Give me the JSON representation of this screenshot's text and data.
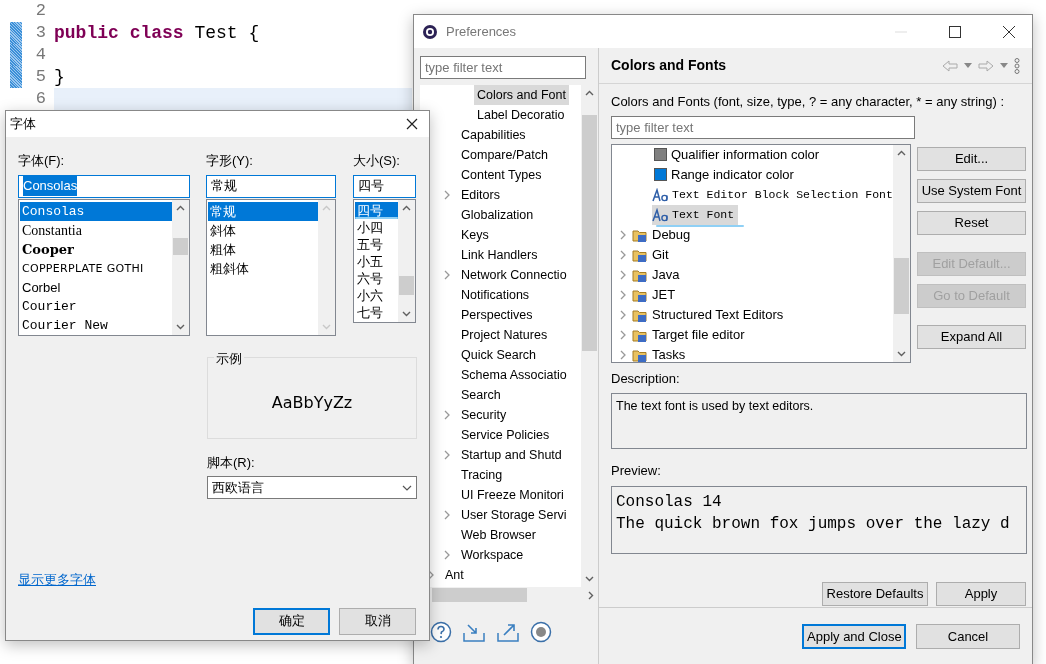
{
  "editor": {
    "lines": [
      {
        "number": "2",
        "changed": false,
        "current": false
      },
      {
        "number": "3",
        "changed": true,
        "current": false,
        "text": "**public** **class** Test {"
      },
      {
        "number": "4",
        "changed": true,
        "current": false
      },
      {
        "number": "5",
        "changed": true,
        "current": false,
        "text": "}"
      },
      {
        "number": "6",
        "changed": false,
        "current": true
      }
    ]
  },
  "preferences": {
    "title": "Preferences",
    "filter": {
      "placeholder": "type filter text"
    },
    "tree": [
      {
        "children": [
          {
            "children": [
              {
                "label": "Colors and Font",
                "expandable": false,
                "selected": true
              },
              {
                "label": "Label Decoratio",
                "expandable": false,
                "selected": false
              }
            ]
          },
          {
            "label": "Capabilities",
            "expandable": false,
            "selected": false
          },
          {
            "label": "Compare/Patch",
            "expandable": false,
            "selected": false
          },
          {
            "label": "Content Types",
            "expandable": false,
            "selected": false
          },
          {
            "label": "Editors",
            "expandable": true,
            "selected": false
          },
          {
            "label": "Globalization",
            "expandable": false,
            "selected": false
          },
          {
            "label": "Keys",
            "expandable": false,
            "selected": false
          },
          {
            "label": "Link Handlers",
            "expandable": false,
            "selected": false
          },
          {
            "label": "Network Connectio",
            "expandable": true,
            "selected": false
          },
          {
            "label": "Notifications",
            "expandable": false,
            "selected": false
          },
          {
            "label": "Perspectives",
            "expandable": false,
            "selected": false
          },
          {
            "label": "Project Natures",
            "expandable": false,
            "selected": false
          },
          {
            "label": "Quick Search",
            "expandable": false,
            "selected": false
          },
          {
            "label": "Schema Associatio",
            "expandable": false,
            "selected": false
          },
          {
            "label": "Search",
            "expandable": false,
            "selected": false
          },
          {
            "label": "Security",
            "expandable": true,
            "selected": false
          },
          {
            "label": "Service Policies",
            "expandable": false,
            "selected": false
          },
          {
            "label": "Startup and Shutd",
            "expandable": true,
            "selected": false
          },
          {
            "label": "Tracing",
            "expandable": false,
            "selected": false
          },
          {
            "label": "UI Freeze Monitori",
            "expandable": false,
            "selected": false
          },
          {
            "label": "User Storage Servi",
            "expandable": true,
            "selected": false
          },
          {
            "label": "Web Browser",
            "expandable": false,
            "selected": false
          },
          {
            "label": "Workspace",
            "expandable": true,
            "selected": false
          }
        ]
      },
      {
        "label": "Ant",
        "expandable": true,
        "selected": false
      }
    ],
    "page": {
      "heading": "Colors and Fonts",
      "filter_label": "Colors and Fonts (font, size, type, ? = any character, * = any string) :",
      "filter": {
        "placeholder": "type filter text"
      },
      "tree": [
        {
          "children": [
            {
              "kind": "color",
              "label": "Qualifier information color",
              "color": "#808080",
              "selected": false
            },
            {
              "kind": "color",
              "label": "Range indicator color",
              "color": "#0078d7",
              "selected": false
            },
            {
              "kind": "font",
              "label": "Text Editor Block Selection Font",
              "selected": false
            },
            {
              "kind": "font",
              "label": "Text Font",
              "selected": true
            }
          ]
        },
        {
          "kind": "category",
          "label": "Debug",
          "selected": false
        },
        {
          "kind": "category",
          "label": "Git",
          "selected": false
        },
        {
          "kind": "category",
          "label": "Java",
          "selected": false
        },
        {
          "kind": "category",
          "label": "JET",
          "selected": false
        },
        {
          "kind": "category",
          "label": "Structured Text Editors",
          "selected": false
        },
        {
          "kind": "category",
          "label": "Target file editor",
          "selected": false
        },
        {
          "kind": "category",
          "label": "Tasks",
          "selected": false
        }
      ],
      "side_buttons": [
        [
          {
            "label": "Edit...",
            "disabled": false
          },
          {
            "label": "Use System Font",
            "disabled": false
          },
          {
            "label": "Reset",
            "disabled": false
          }
        ],
        [
          {
            "label": "Edit Default...",
            "disabled": true
          },
          {
            "label": "Go to Default",
            "disabled": true
          }
        ],
        [
          {
            "label": "Expand All",
            "disabled": false
          }
        ]
      ],
      "description": {
        "label": "Description:",
        "text": "The text font is used by text editors."
      },
      "preview": {
        "label": "Preview:",
        "lines": [
          "Consolas 14",
          "The quick brown fox jumps over the lazy d"
        ]
      },
      "page_buttons": [
        {
          "label": "Restore Defaults",
          "default": false
        },
        {
          "label": "Apply",
          "default": false
        }
      ]
    },
    "dialog_buttons": [
      {
        "label": "Apply and Close",
        "default": true
      },
      {
        "label": "Cancel",
        "default": false
      }
    ]
  },
  "font_dialog": {
    "title": "字体",
    "family": {
      "label": "字体(F):",
      "value": "Consolas",
      "value_selected": true,
      "items": [
        {
          "text": "Consolas",
          "kind": "mono",
          "selected": true
        },
        {
          "text": "Constantia",
          "kind": "serif",
          "selected": false
        },
        {
          "text": "Cooper",
          "kind": "bold",
          "selected": false
        },
        {
          "text": "COPPERPLATE GOTHI",
          "kind": "caps",
          "selected": false
        },
        {
          "text": "Corbel",
          "kind": "sans",
          "selected": false
        },
        {
          "text": "Courier",
          "kind": "mono",
          "selected": false
        },
        {
          "text": "Courier New",
          "kind": "mono",
          "selected": false
        }
      ]
    },
    "style": {
      "label": "字形(Y):",
      "value": "常规",
      "value_selected": false,
      "items": [
        {
          "text": "常规",
          "selected": true
        },
        {
          "text": "斜体",
          "selected": false
        },
        {
          "text": "粗体",
          "selected": false
        },
        {
          "text": "粗斜体",
          "selected": false
        }
      ]
    },
    "size": {
      "label": "大小(S):",
      "value": "四号",
      "value_selected": false,
      "items": [
        {
          "text": "四号",
          "selected": true
        },
        {
          "text": "小四",
          "selected": false
        },
        {
          "text": "五号",
          "selected": false
        },
        {
          "text": "小五",
          "selected": false
        },
        {
          "text": "六号",
          "selected": false
        },
        {
          "text": "小六",
          "selected": false
        },
        {
          "text": "七号",
          "selected": false
        }
      ]
    },
    "sample": {
      "legend": "示例",
      "text": "AaBbYyZz"
    },
    "script": {
      "label": "脚本(R):",
      "value": "西欧语言"
    },
    "more_fonts_link": "显示更多字体",
    "buttons": [
      {
        "label": "确定",
        "default": true
      },
      {
        "label": "取消",
        "default": false
      }
    ]
  }
}
